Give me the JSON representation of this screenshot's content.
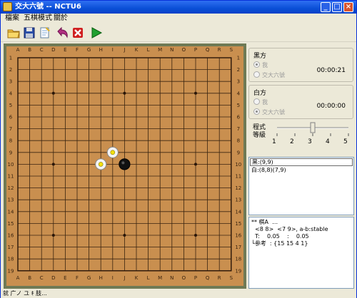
{
  "title": "交大六號 -- NCTU6",
  "menu": [
    "檔案",
    "五棋模式",
    "關於"
  ],
  "toolbar": [
    {
      "name": "open-folder-icon",
      "color": "#f0c040"
    },
    {
      "name": "save-icon",
      "color": "#2b4fa8"
    },
    {
      "name": "edit-document-icon",
      "color": "#7fa8d8"
    },
    {
      "name": "undo-arrow-icon",
      "color": "#b03080"
    },
    {
      "name": "stop-x-icon",
      "color": "#d02020"
    },
    {
      "name": "play-icon",
      "color": "#20a030"
    }
  ],
  "board": {
    "columns": [
      "A",
      "B",
      "C",
      "D",
      "E",
      "F",
      "G",
      "H",
      "I",
      "J",
      "K",
      "L",
      "M",
      "N",
      "O",
      "P",
      "Q",
      "R",
      "S"
    ],
    "rows": [
      "1",
      "2",
      "3",
      "4",
      "5",
      "6",
      "7",
      "8",
      "9",
      "10",
      "11",
      "12",
      "13",
      "14",
      "15",
      "16",
      "17",
      "18",
      "19"
    ],
    "stones": [
      {
        "col": 8,
        "row": 9,
        "color": "white"
      },
      {
        "col": 7,
        "row": 10,
        "color": "white"
      },
      {
        "col": 9,
        "row": 10,
        "color": "black"
      }
    ]
  },
  "black": {
    "title": "黑方",
    "option_me": "我",
    "option_ai": "交大六號",
    "selected": "me",
    "time": "00:00:21"
  },
  "white": {
    "title": "白方",
    "option_me": "我",
    "option_ai": "交大六號",
    "selected": "ai",
    "time": "00:00:00"
  },
  "level": {
    "label_line1": "程式",
    "label_line2": "等級",
    "ticks": [
      "1",
      "2",
      "3",
      "4",
      "5"
    ],
    "value": 3
  },
  "moves": {
    "selected": "黑:(9,9)",
    "line2": "白:(8,8)(7,9)"
  },
  "log": {
    "lines": [
      "** 棋A  …",
      "  <8 8>  <7 9>, a-b:stable",
      "  T:    0.05    :    0.05",
      "└参考  : {15 15 4 1}"
    ]
  },
  "status": "就  广ノ ユ  ｷ 肢..."
}
